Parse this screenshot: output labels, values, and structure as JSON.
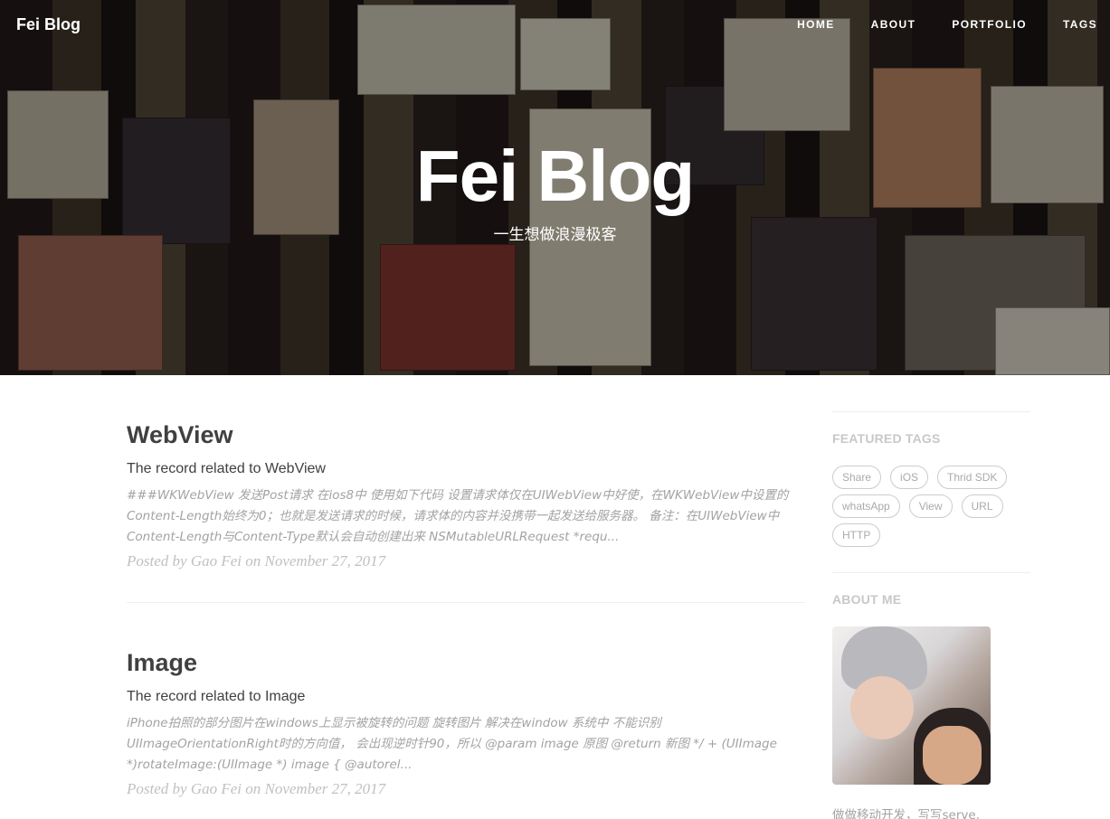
{
  "nav": {
    "brand": "Fei Blog",
    "links": [
      "HOME",
      "ABOUT",
      "PORTFOLIO",
      "TAGS"
    ]
  },
  "hero": {
    "title": "Fei Blog",
    "subtitle": "一生想做浪漫极客"
  },
  "posts": [
    {
      "title": "WebView",
      "subtitle": "The record related to WebView",
      "excerpt": "###WKWebView 发送Post请求 在ios8中 使用如下代码 设置请求体仅在UIWebView中好使，在WKWebView中设置的 Content-Length始终为0；也就是发送请求的时候，请求体的内容并没携带一起发送给服务器。 备注：在UIWebView中 Content-Length与Content-Type默认会自动创建出来 NSMutableURLRequest *requ...",
      "meta": "Posted by Gao Fei on November 27, 2017"
    },
    {
      "title": "Image",
      "subtitle": "The record related to Image",
      "excerpt": "iPhone拍照的部分图片在windows上显示被旋转的问题 旋转图片 解决在window 系统中 不能识别 UIImageOrientationRight时的方向值， 会出现逆时针90，所以 @param image 原图 @return 新图 */ + (UIImage *)rotateImage:(UIImage *) image { @autorel...",
      "meta": "Posted by Gao Fei on November 27, 2017"
    }
  ],
  "sidebar": {
    "featured_tags_heading": "FEATURED TAGS",
    "tags": [
      "Share",
      "iOS",
      "Thrid SDK",
      "whatsApp",
      "View",
      "URL",
      "HTTP"
    ],
    "about_heading": "ABOUT ME",
    "about_text": "做做移动开发，写写serve,"
  }
}
